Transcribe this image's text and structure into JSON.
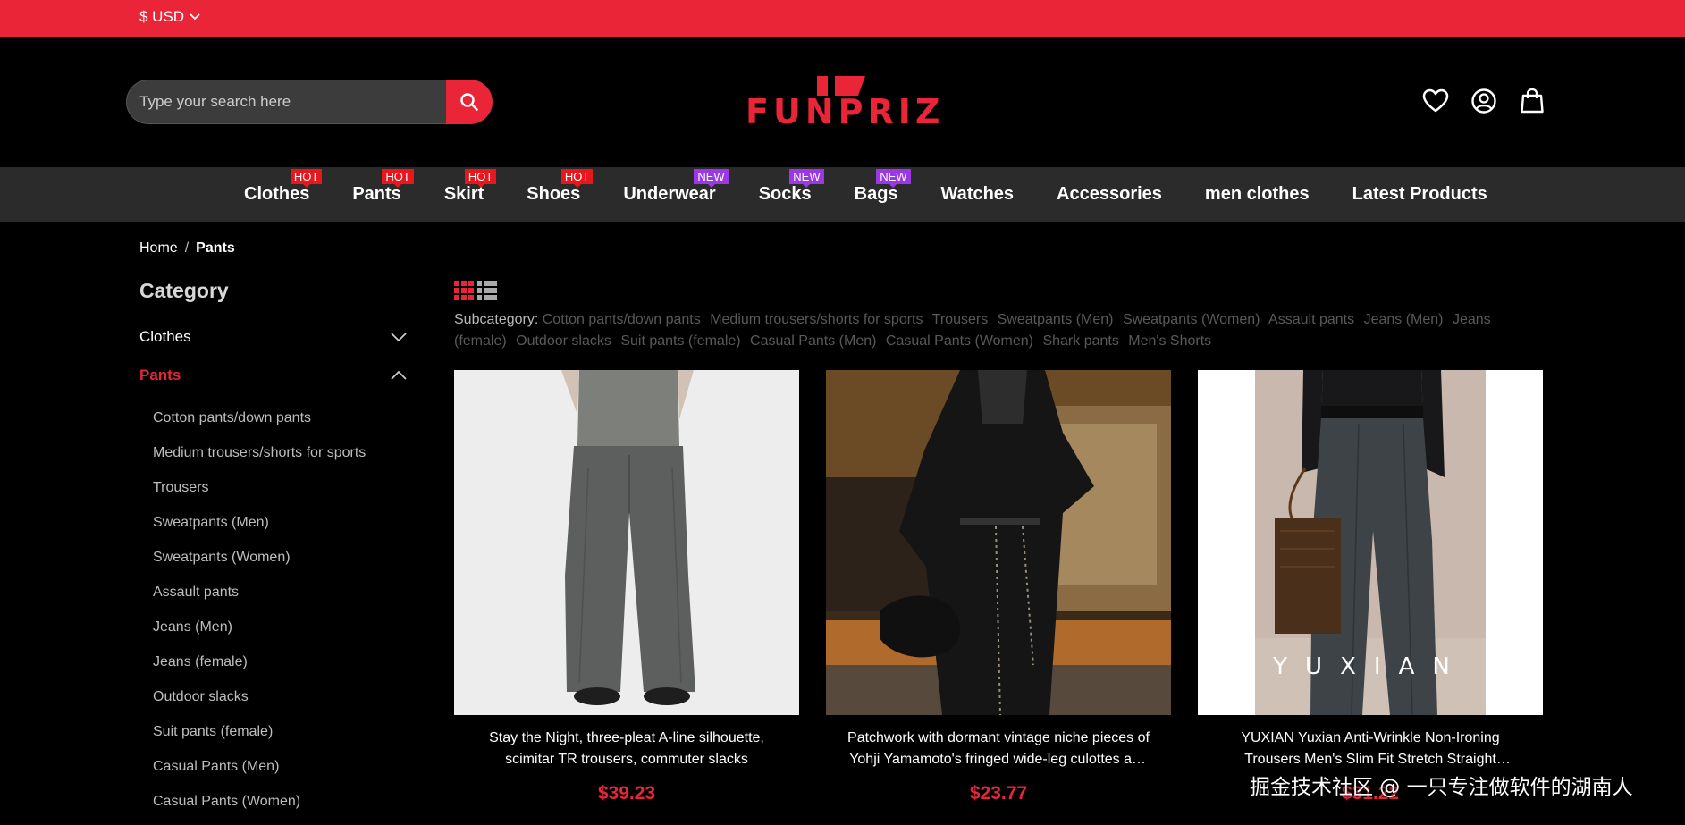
{
  "topbar": {
    "currency": "$ USD"
  },
  "search": {
    "placeholder": "Type your search here"
  },
  "logo": {
    "text": "FUNPRIZ"
  },
  "nav": [
    {
      "label": "Clothes",
      "badge": "HOT",
      "badge_type": "hot"
    },
    {
      "label": "Pants",
      "badge": "HOT",
      "badge_type": "hot"
    },
    {
      "label": "Skirt",
      "badge": "HOT",
      "badge_type": "hot"
    },
    {
      "label": "Shoes",
      "badge": "HOT",
      "badge_type": "hot"
    },
    {
      "label": "Underwear",
      "badge": "NEW",
      "badge_type": "new"
    },
    {
      "label": "Socks",
      "badge": "NEW",
      "badge_type": "new"
    },
    {
      "label": "Bags",
      "badge": "NEW",
      "badge_type": "new"
    },
    {
      "label": "Watches",
      "badge": "",
      "badge_type": ""
    },
    {
      "label": "Accessories",
      "badge": "",
      "badge_type": ""
    },
    {
      "label": "men clothes",
      "badge": "",
      "badge_type": ""
    },
    {
      "label": "Latest Products",
      "badge": "",
      "badge_type": ""
    }
  ],
  "breadcrumb": {
    "home": "Home",
    "separator": "/",
    "current": "Pants"
  },
  "sidebar": {
    "title": "Category",
    "categories": [
      {
        "label": "Clothes",
        "expanded": false
      },
      {
        "label": "Pants",
        "expanded": true
      }
    ],
    "subitems": [
      "Cotton pants/down pants",
      "Medium trousers/shorts for sports",
      "Trousers",
      "Sweatpants (Men)",
      "Sweatpants (Women)",
      "Assault pants",
      "Jeans (Men)",
      "Jeans (female)",
      "Outdoor slacks",
      "Suit pants (female)",
      "Casual Pants (Men)",
      "Casual Pants (Women)"
    ]
  },
  "subcategory": {
    "label": "Subcategory:",
    "tags": [
      "Cotton pants/down pants",
      "Medium trousers/shorts for sports",
      "Trousers",
      "Sweatpants (Men)",
      "Sweatpants (Women)",
      "Assault pants",
      "Jeans (Men)",
      "Jeans (female)",
      "Outdoor slacks",
      "Suit pants (female)",
      "Casual Pants (Men)",
      "Casual Pants (Women)",
      "Shark pants",
      "Men's Shorts"
    ]
  },
  "products": [
    {
      "name": "Stay the Night, three-pleat A-line silhouette, scimitar TR trousers, commuter slacks",
      "price": "$39.23"
    },
    {
      "name": "Patchwork with dormant vintage niche pieces of Yohji Yamamoto's fringed wide-leg culottes and wide-leg pants",
      "price": "$23.77"
    },
    {
      "name": "YUXIAN Yuxian Anti-Wrinkle Non-Ironing Trousers Men's Slim Fit Stretch Straight Commuter Pants Business",
      "price": "$31.22",
      "image_text": "YUXIAN"
    }
  ],
  "watermark": "掘金技术社区 @ 一只专注做软件的湖南人",
  "colors": {
    "accent": "#ea2538",
    "hot_badge": "#e8161d",
    "new_badge": "#9c37e6",
    "nav_bg": "#2b2b2b"
  }
}
